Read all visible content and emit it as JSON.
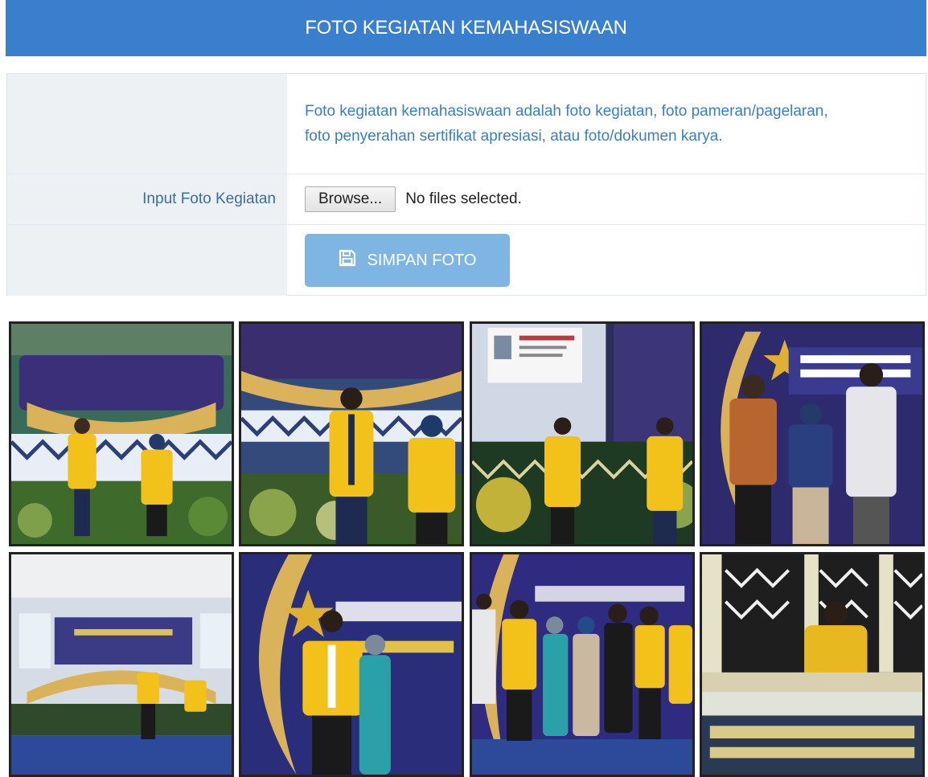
{
  "header": {
    "title": "FOTO KEGIATAN KEMAHASISWAAN"
  },
  "form": {
    "description": "Foto kegiatan kemahasiswaan adalah foto kegiatan, foto pameran/pagelaran, foto penyerahan sertifikat apresiasi, atau foto/dokumen karya.",
    "input_label": "Input Foto Kegiatan",
    "browse_label": "Browse...",
    "file_status": "No files selected.",
    "save_label": "SIMPAN FOTO",
    "save_icon": "floppy-disk-icon"
  },
  "colors": {
    "header_bg": "#3a7fce",
    "save_button_bg": "#7fb5e3",
    "label_text": "#3d6c9e",
    "description_text": "#3a7fc4"
  },
  "gallery": {
    "photos": [
      {
        "scene": "stage-two-students",
        "shirt": "#f2c21a",
        "backdrop": "#3c2f7a"
      },
      {
        "scene": "stage-closeup",
        "shirt": "#f2c21a",
        "backdrop": "#3a2e6e"
      },
      {
        "scene": "presentation-screen",
        "shirt": "#f2c21a",
        "backdrop": "#2b2e5a"
      },
      {
        "scene": "group-of-three",
        "shirt": "#b9652f",
        "backdrop": "#2e2a6e"
      },
      {
        "scene": "hall-wide",
        "shirt": "#f2c21a",
        "backdrop": "#5b7db4"
      },
      {
        "scene": "crescent-stage",
        "shirt": "#f2c21a",
        "backdrop": "#2a2d7a"
      },
      {
        "scene": "large-group",
        "shirt": "#f2c21a",
        "backdrop": "#2e2b80"
      },
      {
        "scene": "recitation-table",
        "shirt": "#f2c21a",
        "backdrop": "#1e1e1e"
      }
    ]
  }
}
